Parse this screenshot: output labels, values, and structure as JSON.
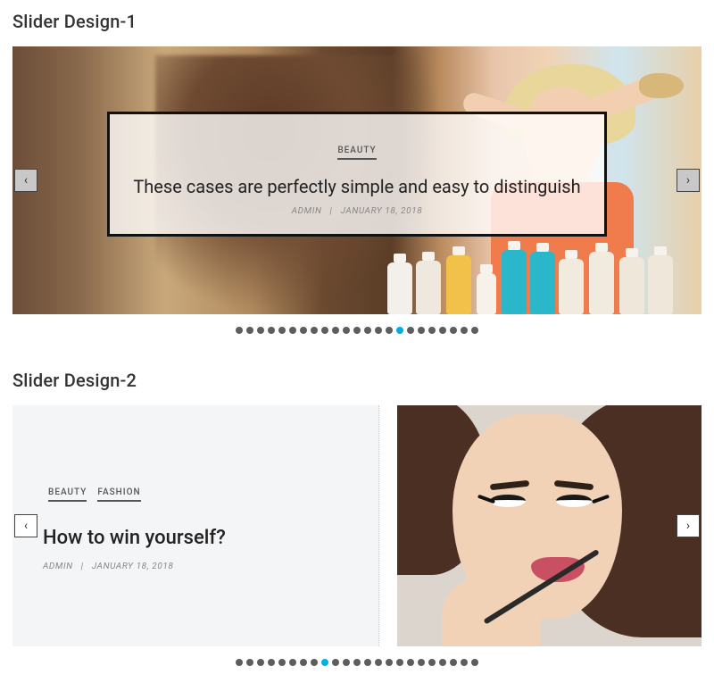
{
  "headings": {
    "slider1": "Slider Design-1",
    "slider2": "Slider Design-2"
  },
  "slider1": {
    "category": "BEAUTY",
    "title": "These cases are perfectly simple and easy to distinguish",
    "author": "ADMIN",
    "date": "JANUARY 18, 2018",
    "dot_count": 23,
    "active_dot": 15
  },
  "slider2": {
    "categories": [
      "BEAUTY",
      "FASHION"
    ],
    "title": "How to win yourself?",
    "author": "ADMIN",
    "date": "JANUARY 18, 2018",
    "dot_count": 23,
    "active_dot": 8
  },
  "nav": {
    "prev": "‹",
    "next": "›",
    "sep": "|"
  }
}
